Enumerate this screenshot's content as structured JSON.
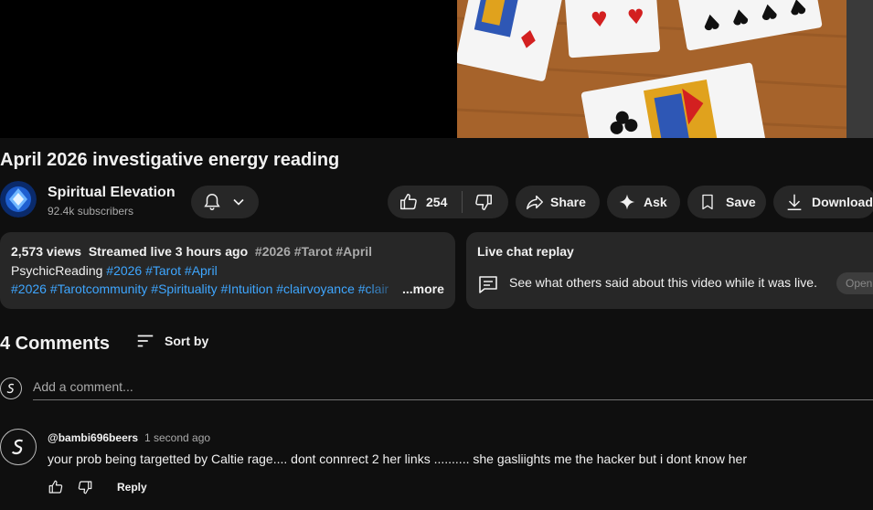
{
  "video": {
    "title": "April 2026 investigative energy reading"
  },
  "channel": {
    "name": "Spiritual Elevation",
    "subscribers": "92.4k subscribers"
  },
  "actions": {
    "like_count": "254",
    "share_label": "Share",
    "ask_label": "Ask",
    "save_label": "Save",
    "download_label": "Download"
  },
  "description": {
    "views": "2,573 views",
    "streamed": "Streamed live 3 hours ago",
    "inline_tags": "#2026 #Tarot #April",
    "line2_text": "PsychicReading",
    "line2_tags": "#2026 #Tarot #April",
    "line3_tags": "#2026 #Tarotcommunity #Spirituality #Intuition #clairvoyance #clair",
    "more_label": "...more"
  },
  "live_chat": {
    "title": "Live chat replay",
    "text": "See what others said about this video while it was live.",
    "open_label": "Open"
  },
  "comments": {
    "count_label": "4 Comments",
    "sort_label": "Sort by",
    "add_placeholder": "Add a comment...",
    "items": [
      {
        "author": "@bambi696beers",
        "time": "1 second ago",
        "text": "your prob being targetted by Caltie rage.... dont connrect 2 her links ..........  she gasliights me the hacker but i dont know her",
        "reply_label": "Reply"
      }
    ]
  },
  "icons": {
    "bell": "bell-icon",
    "chevron": "chevron-down-icon",
    "like": "thumbs-up-icon",
    "dislike": "thumbs-down-icon",
    "share": "share-icon",
    "ask": "sparkle-icon",
    "save": "bookmark-icon",
    "download": "download-icon",
    "chat": "chat-icon",
    "sort": "sort-icon"
  },
  "colors": {
    "background": "#0f0f0f",
    "pill": "#272727",
    "link": "#3ea6ff",
    "secondary_text": "#aaaaaa"
  }
}
